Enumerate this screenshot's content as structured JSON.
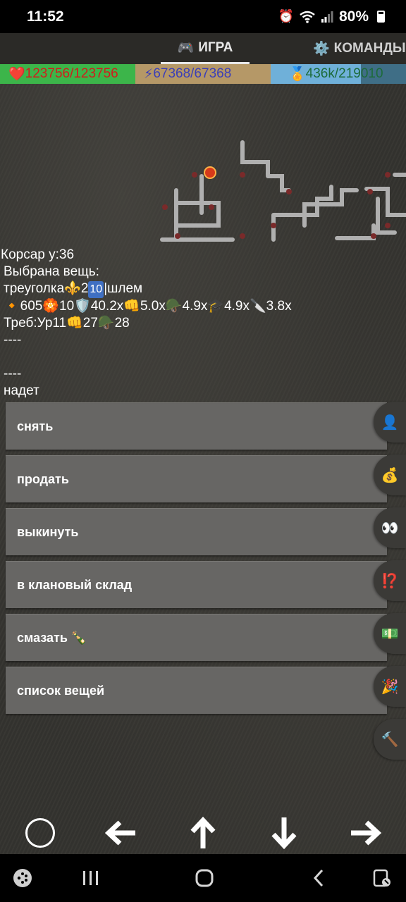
{
  "status_bar": {
    "time": "11:52",
    "battery": "80%",
    "icons": [
      "alarm-icon",
      "wifi-icon",
      "signal-icon",
      "battery-icon"
    ]
  },
  "tabs": [
    {
      "label": "ИГРА",
      "icon": "gamepad-icon",
      "active": true
    },
    {
      "label": "КОМАНДЫ",
      "icon": "gear-icon",
      "active": false
    }
  ],
  "stats": {
    "hp": {
      "icon": "❤️",
      "text": "123756/123756"
    },
    "mp": {
      "icon": "⚡",
      "text": "67368/67368"
    },
    "xp": {
      "icon": "🏅",
      "text": "436k/219010",
      "progress_percent": 67
    }
  },
  "info": {
    "player_line": "Корсар  у:36",
    "selected_label": "Выбрана вещь:",
    "item_name": "треуголка⚜️2",
    "item_level": "10",
    "item_type": "|шлем",
    "item_stats": "🔸605🏵️10🛡️40.2x👊5.0x🪖4.9x🎓4.9x🔪3.8x",
    "requirements": "Треб:Ур11👊27🪖28",
    "sep1": "----",
    "sep2": "----",
    "state": "надет"
  },
  "menu": [
    {
      "label": "снять"
    },
    {
      "label": "продать"
    },
    {
      "label": "выкинуть"
    },
    {
      "label": "в клановый склад"
    },
    {
      "label": "смазать 🍾"
    },
    {
      "label": "список вещей"
    }
  ],
  "side_buttons": [
    {
      "icon": "👤",
      "name": "person-icon"
    },
    {
      "icon": "💰",
      "name": "money-bag-icon"
    },
    {
      "icon": "👀",
      "name": "eyes-icon"
    },
    {
      "icon": "⁉️",
      "name": "question-icon"
    },
    {
      "icon": "💵",
      "name": "money-icon"
    },
    {
      "icon": "🎉",
      "name": "party-icon"
    },
    {
      "icon": "🔨",
      "name": "hammer-icon"
    }
  ]
}
